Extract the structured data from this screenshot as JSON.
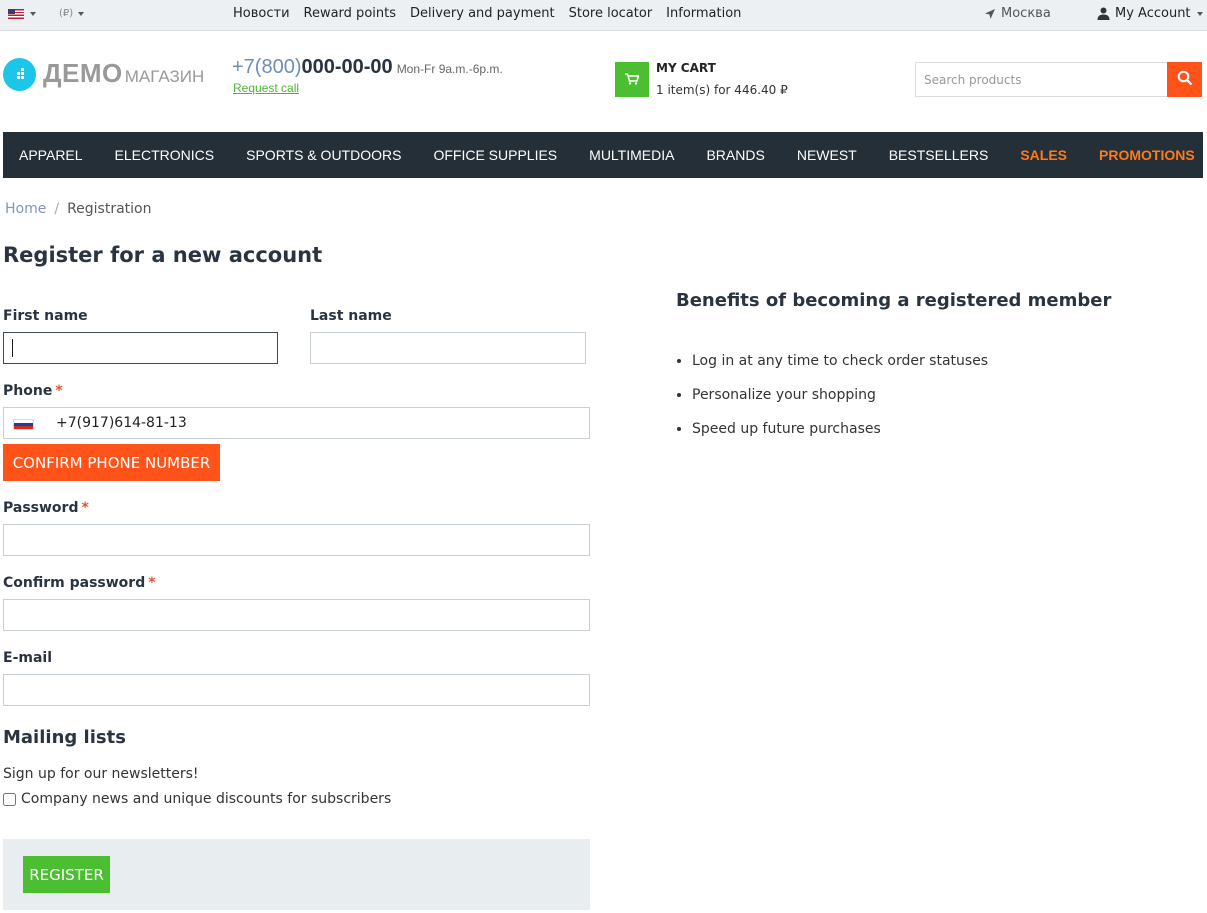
{
  "topbar": {
    "currency": "(₽)",
    "links": [
      "Новости",
      "Reward points",
      "Delivery and payment",
      "Store locator",
      "Information"
    ],
    "city": "Москва",
    "account": "My Account"
  },
  "header": {
    "logo_main": "ДЕМО",
    "logo_sub": "МАГАЗИН",
    "phone_code": "+7(800)",
    "phone_number": "000-00-00",
    "hours": "Mon-Fr 9a.m.-6p.m.",
    "request_call": "Request call",
    "cart_title": "MY CART",
    "cart_summary": "1 item(s) for 446.40 ₽",
    "search_placeholder": "Search products"
  },
  "nav": {
    "items": [
      "APPAREL",
      "ELECTRONICS",
      "SPORTS & OUTDOORS",
      "OFFICE SUPPLIES",
      "MULTIMEDIA",
      "BRANDS",
      "NEWEST",
      "BESTSELLERS",
      "SALES",
      "PROMOTIONS"
    ]
  },
  "breadcrumb": {
    "home": "Home",
    "separator": "/",
    "current": "Registration"
  },
  "form": {
    "title": "Register for a new account",
    "first_name_label": "First name",
    "first_name_value": "",
    "last_name_label": "Last name",
    "last_name_value": "",
    "phone_label": "Phone",
    "phone_value": "+7(917)614-81-13",
    "required_mark": "*",
    "confirm_phone": "CONFIRM PHONE NUMBER",
    "password_label": "Password",
    "confirm_password_label": "Confirm password",
    "email_label": "E-mail",
    "mailing_title": "Mailing lists",
    "signup_text": "Sign up for our newsletters!",
    "newsletter_label": "Company news and unique discounts for subscribers",
    "newsletter_checked": false,
    "register": "REGISTER"
  },
  "benefits": {
    "title": "Benefits of becoming a registered member",
    "items": [
      "Log in at any time to check order statuses",
      "Personalize your shopping",
      "Speed up future purchases"
    ]
  },
  "colors": {
    "accent_orange": "#ff5319",
    "accent_green": "#4cbe31",
    "nav_bg": "#252f37",
    "nav_hot": "#ff7a1a",
    "logo_blue": "#1cc6e8"
  }
}
